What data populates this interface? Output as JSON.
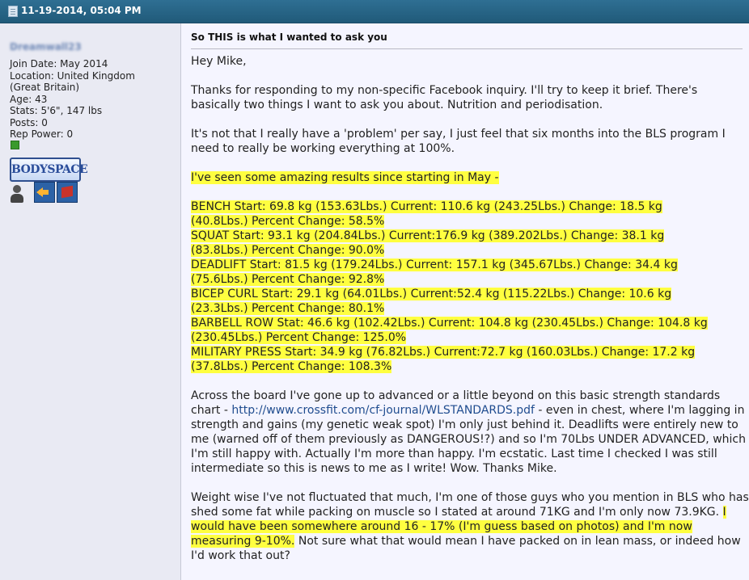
{
  "post": {
    "date": "11-19-2014, 05:04 PM",
    "subject": "So THIS is what I wanted to ask you"
  },
  "user": {
    "name": "Dreamwall23",
    "join_date": "Join Date: May 2014",
    "location_line1": "Location: United Kingdom",
    "location_line2": "(Great Britain)",
    "age": "Age: 43",
    "stats": "Stats: 5'6\", 147 lbs",
    "posts": "Posts: 0",
    "rep_power": "Rep Power: 0",
    "bodyspace_label": "BODYSPACE"
  },
  "message": {
    "greeting": "Hey Mike,",
    "p1": "Thanks for responding to my non-specific Facebook inquiry. I'll try to keep it brief. There's basically two things I want to ask you about. Nutrition and periodisation.",
    "p2": "It's not that I really have a 'problem' per say, I just feel that six months into the BLS program I need to really be working everything at 100%.",
    "results_intro": "I've seen some amazing results since starting in May -",
    "lifts": [
      {
        "a": "BENCH Start: 69.8 kg (153.63Lbs.) Current: 110.6 kg (243.25Lbs.) Change: 18.5 kg",
        "b": "(40.8Lbs.) Percent Change: 58.5%"
      },
      {
        "a": "SQUAT Start: 93.1 kg (204.84Lbs.) Current:176.9 kg (389.202Lbs.) Change: 38.1 kg",
        "b": "(83.8Lbs.) Percent Change: 90.0%"
      },
      {
        "a": "DEADLIFT Start: 81.5 kg (179.24Lbs.) Current: 157.1 kg (345.67Lbs.) Change: 34.4 kg",
        "b": "(75.6Lbs.) Percent Change: 92.8%"
      },
      {
        "a": "BICEP CURL Start: 29.1 kg (64.01Lbs.) Current:52.4 kg (115.22Lbs.) Change: 10.6 kg",
        "b": "(23.3Lbs.) Percent Change: 80.1%"
      },
      {
        "a": "BARBELL ROW Stat: 46.6 kg (102.42Lbs.) Current: 104.8 kg (230.45Lbs.) Change: 104.8 kg",
        "b": "(230.45Lbs.) Percent Change: 125.0%"
      },
      {
        "a": "MILITARY PRESS Start: 34.9 kg (76.82Lbs.) Current:72.7 kg (160.03Lbs.) Change: 17.2 kg",
        "b": "(37.8Lbs.) Percent Change: 108.3%"
      }
    ],
    "p3_before": "Across the board I've gone up to advanced or a little beyond on this basic strength standards chart - ",
    "p3_link": "http://www.crossfit.com/cf-journal/WLSTANDARDS.pdf",
    "p3_after": " - even in chest, where I'm lagging in strength and gains (my genetic weak spot) I'm only just behind it. Deadlifts were entirely new to me (warned off of them previously as DANGEROUS!?) and so I'm 70Lbs UNDER ADVANCED, which I'm still happy with. Actually I'm more than happy. I'm ecstatic. Last time I checked I was still intermediate so this is news to me as I write! Wow. Thanks Mike.",
    "p4_before": "Weight wise I've not fluctuated that much, I'm one of those guys who you mention in BLS who has shed some fat while packing on muscle so I stated at around 71KG and I'm only now 73.9KG. ",
    "p4_hl": "I would have been somewhere around 16 - 17% (I'm guess based on photos) and I'm now measuring 9-10%.",
    "p4_after": " Not sure what that would mean I have packed on in lean mass, or indeed how I'd work that out?"
  }
}
